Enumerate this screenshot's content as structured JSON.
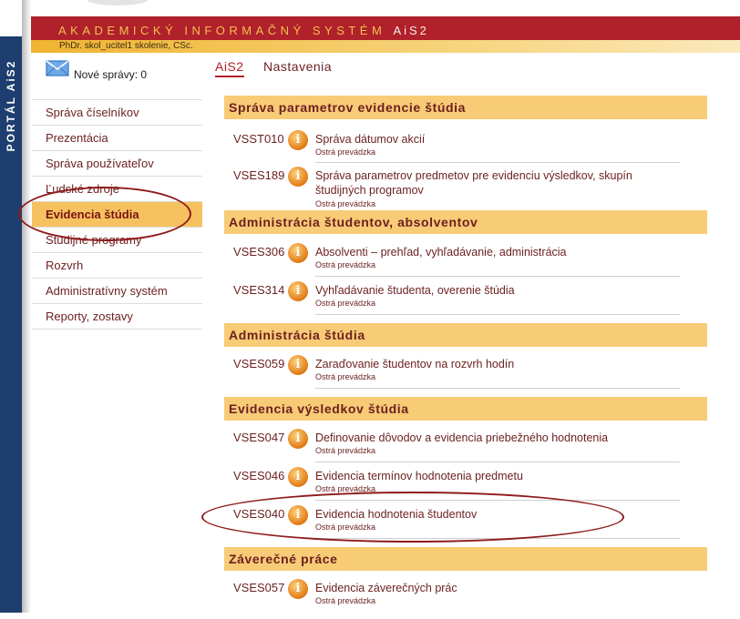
{
  "portal_tab": {
    "label": "PORTÁL AiS2"
  },
  "header": {
    "title": "AKADEMICKÝ INFORMAČNÝ SYSTÉM",
    "brand": "AiS2",
    "user": "PhDr. skol_ucitel1 skolenie, CSc."
  },
  "messages": {
    "label": "Nové správy: 0",
    "icon": "envelope-icon"
  },
  "top_tabs": [
    {
      "label": "AiS2",
      "active": true
    },
    {
      "label": "Nastavenia",
      "active": false
    }
  ],
  "sidebar": {
    "items": [
      {
        "label": "Správa číselníkov"
      },
      {
        "label": "Prezentácia"
      },
      {
        "label": "Správa používateľov"
      },
      {
        "label": "Ľudské zdroje"
      },
      {
        "label": "Evidencia štúdia",
        "active": true
      },
      {
        "label": "Študijné programy"
      },
      {
        "label": "Rozvrh"
      },
      {
        "label": "Administratívny systém"
      },
      {
        "label": "Reporty, zostavy"
      }
    ]
  },
  "sections": [
    {
      "title": "Správa parametrov evidencie štúdia",
      "apps": [
        {
          "code": "VSST010",
          "name": "Správa dátumov akcií",
          "status": "Ostrá prevádzka"
        },
        {
          "code": "VSES189",
          "name": "Správa parametrov predmetov pre evidenciu výsledkov, skupín študijných programov",
          "status": "Ostrá prevádzka"
        }
      ]
    },
    {
      "title": "Administrácia študentov, absolventov",
      "apps": [
        {
          "code": "VSES306",
          "name": "Absolventi – prehľad, vyhľadávanie, administrácia",
          "status": "Ostrá prevádzka"
        },
        {
          "code": "VSES314",
          "name": "Vyhľadávanie študenta, overenie štúdia",
          "status": "Ostrá prevádzka"
        }
      ]
    },
    {
      "title": "Administrácia štúdia",
      "apps": [
        {
          "code": "VSES059",
          "name": "Zaraďovanie študentov na rozvrh hodín",
          "status": "Ostrá prevádzka"
        }
      ]
    },
    {
      "title": "Evidencia výsledkov štúdia",
      "apps": [
        {
          "code": "VSES047",
          "name": "Definovanie dôvodov a evidencia priebežného hodnotenia",
          "status": "Ostrá prevádzka"
        },
        {
          "code": "VSES046",
          "name": "Evidencia termínov hodnotenia predmetu",
          "status": "Ostrá prevádzka"
        },
        {
          "code": "VSES040",
          "name": "Evidencia hodnotenia študentov",
          "status": "Ostrá prevádzka"
        }
      ]
    },
    {
      "title": "Záverečné práce",
      "apps": [
        {
          "code": "VSES057",
          "name": "Evidencia záverečných prác",
          "status": "Ostrá prevádzka"
        }
      ]
    }
  ],
  "colors": {
    "accent_red": "#b0212b",
    "section_bg": "#f8cb76",
    "nav_active": "#f6c260",
    "text": "#6b1f1f"
  }
}
